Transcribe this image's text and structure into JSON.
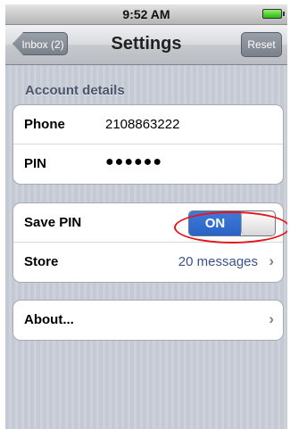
{
  "status_bar": {
    "time": "9:52 AM",
    "battery": "battery-full-icon"
  },
  "nav": {
    "back_label": "Inbox (2)",
    "title": "Settings",
    "reset_label": "Reset"
  },
  "account": {
    "header": "Account details",
    "phone_label": "Phone",
    "phone_value": "2108863222",
    "pin_label": "PIN",
    "pin_value": "●●●●●●"
  },
  "options": {
    "save_pin_label": "Save PIN",
    "save_pin_state": "ON",
    "store_label": "Store",
    "store_value": "20 messages"
  },
  "about": {
    "label": "About..."
  },
  "colors": {
    "toggle_on": "#2a63c7",
    "highlight": "#e3171b",
    "detail_text": "#385487",
    "section_header": "#4c566c"
  }
}
